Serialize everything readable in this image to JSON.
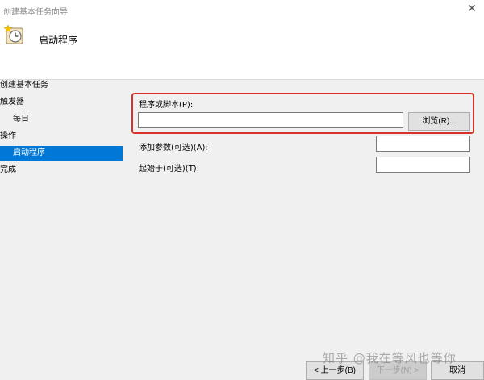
{
  "window": {
    "title": "创建基本任务向导",
    "close_glyph": "✕"
  },
  "header": {
    "title": "启动程序",
    "icon": "scheduled-task-clock-icon"
  },
  "sidebar": {
    "items": [
      {
        "label": "创建基本任务"
      },
      {
        "label": "触发器"
      },
      {
        "label": "每日"
      },
      {
        "label": "操作"
      },
      {
        "label": "启动程序"
      },
      {
        "label": "完成"
      }
    ],
    "active_item": "启动程序"
  },
  "form": {
    "program_label": "程序或脚本(P):",
    "program_value": "",
    "browse_label": "浏览(R)...",
    "args_label": "添加参数(可选)(A):",
    "args_value": "",
    "startin_label": "起始于(可选)(T):",
    "startin_value": ""
  },
  "footer": {
    "back_label": "< 上一步(B)",
    "next_label": "下一步(N) >",
    "cancel_label": "取消"
  },
  "watermark": "知乎 @我在等风也等你",
  "colors": {
    "selection": "#0078d7",
    "highlight": "#d9302c",
    "window_bg": "#f0f0f0"
  }
}
